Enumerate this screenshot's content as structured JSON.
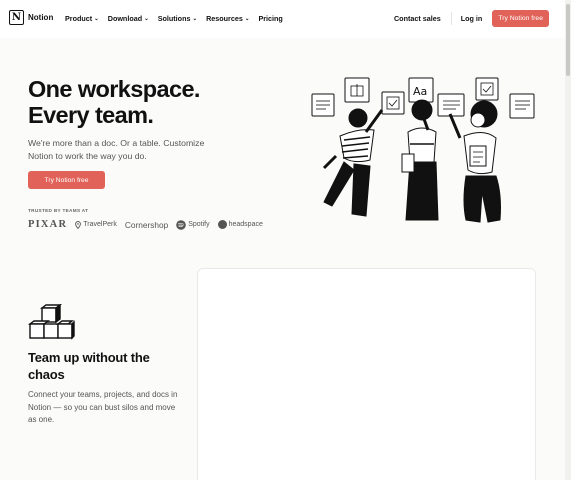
{
  "brand": {
    "name": "Notion",
    "mark": "N"
  },
  "nav": {
    "items": [
      {
        "label": "Product",
        "icon": "chevron-down-icon"
      },
      {
        "label": "Download",
        "icon": "chevron-down-icon"
      },
      {
        "label": "Solutions",
        "icon": "chevron-down-icon"
      },
      {
        "label": "Resources",
        "icon": "chevron-down-icon"
      },
      {
        "label": "Pricing"
      }
    ],
    "contact_sales": "Contact sales",
    "log_in": "Log in",
    "cta": "Try Notion free"
  },
  "hero": {
    "title_line1": "One workspace.",
    "title_line2": "Every team.",
    "subtitle": "We're more than a doc. Or a table. Customize Notion to work the way you do.",
    "cta": "Try Notion free",
    "trusted_label": "TRUSTED BY TEAMS AT",
    "logos": [
      {
        "name": "PIXAR"
      },
      {
        "name": "TravelPerk",
        "icon": "location-pin-icon"
      },
      {
        "name": "Cornershop"
      },
      {
        "name": "Spotify",
        "icon": "spotify-icon"
      },
      {
        "name": "headspace",
        "icon": "headspace-dot-icon"
      }
    ],
    "illustration_text": "Aa"
  },
  "feature": {
    "title": "Team up without the chaos",
    "description": "Connect your teams, projects, and docs in Notion — so you can bust silos and move as one."
  },
  "colors": {
    "accent": "#e16259",
    "page_bg": "#fbfbfa",
    "text": "#111111",
    "muted": "#555555"
  }
}
